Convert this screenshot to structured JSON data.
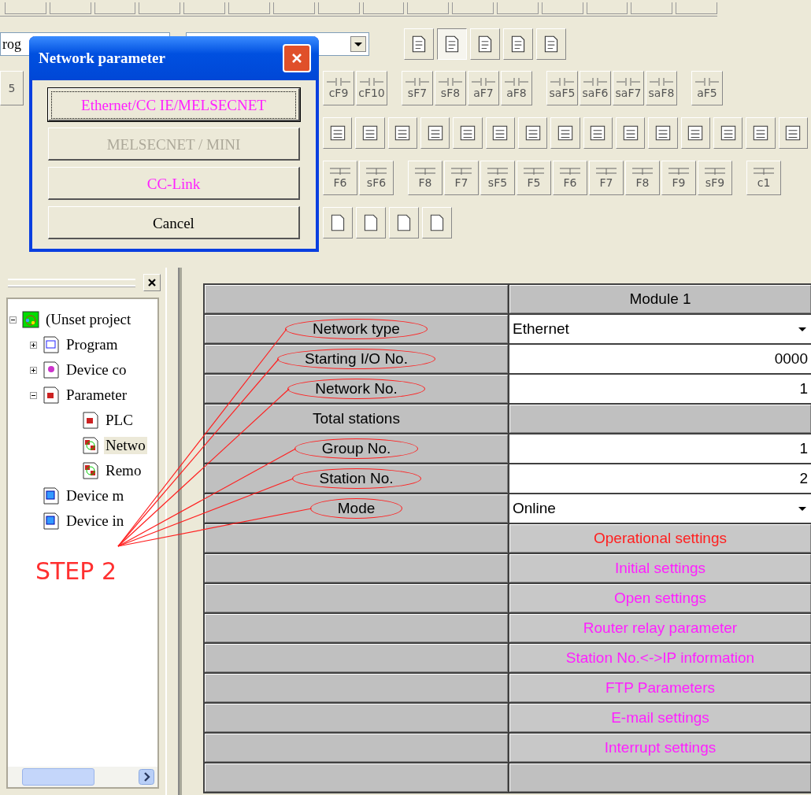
{
  "toolbar": {
    "program_combo": {
      "value": "rog"
    },
    "key_row_1": {
      "stub": "5",
      "groups": [
        [
          "cF9",
          "cF10"
        ],
        [
          "sF7",
          "sF8",
          "aF7",
          "aF8"
        ],
        [
          "saF5",
          "saF6",
          "saF7",
          "saF8"
        ],
        [
          "aF5"
        ]
      ]
    },
    "key_row_2": {
      "groups": [
        [
          "F6",
          "sF6"
        ],
        [
          "F8",
          "F7",
          "sF5",
          "F5",
          "F6",
          "F7",
          "F8",
          "F9",
          "sF9"
        ],
        [
          "c1"
        ]
      ]
    }
  },
  "dialog": {
    "title": "Network parameter",
    "buttons": [
      {
        "label": "Ethernet/CC IE/MELSECNET",
        "kind": "network",
        "disabled": false,
        "focused": true
      },
      {
        "label": "MELSECNET / MINI",
        "kind": "network",
        "disabled": true,
        "focused": false
      },
      {
        "label": "CC-Link",
        "kind": "network",
        "disabled": false,
        "focused": false
      },
      {
        "label": "Cancel",
        "kind": "plain",
        "disabled": false,
        "focused": false
      }
    ]
  },
  "tree": [
    {
      "label": "(Unset project",
      "kind": "project",
      "expanded": true,
      "selected": false,
      "children": [
        {
          "label": "Program",
          "kind": "program",
          "expanded": false,
          "selected": false
        },
        {
          "label": "Device co",
          "kind": "comment",
          "expanded": false,
          "selected": false
        },
        {
          "label": "Parameter",
          "kind": "parameter",
          "expanded": true,
          "selected": false,
          "children": [
            {
              "label": "PLC",
              "kind": "parameter",
              "selected": false
            },
            {
              "label": "Netwo",
              "kind": "network",
              "selected": true
            },
            {
              "label": "Remo",
              "kind": "network",
              "selected": false
            }
          ]
        },
        {
          "label": "Device m",
          "kind": "device",
          "selected": false
        },
        {
          "label": "Device in",
          "kind": "device-init",
          "selected": false
        }
      ]
    }
  ],
  "annotation": {
    "label": "STEP 2"
  },
  "grid": {
    "header": "Module 1",
    "rows": [
      {
        "label": "Network type",
        "kind": "dropdown",
        "value": "Ethernet",
        "circled": true
      },
      {
        "label": "Starting I/O No.",
        "kind": "number",
        "value": "0000",
        "circled": true
      },
      {
        "label": "Network No.",
        "kind": "number",
        "value": "1",
        "circled": true
      },
      {
        "label": "Total stations",
        "kind": "blank",
        "circled": false
      },
      {
        "label": "Group No.",
        "kind": "number",
        "value": "1",
        "circled": true
      },
      {
        "label": "Station No.",
        "kind": "number",
        "value": "2",
        "circled": true
      },
      {
        "label": "Mode",
        "kind": "dropdown",
        "value": "Online",
        "circled": true
      }
    ],
    "setting_buttons": [
      {
        "label": "Operational settings",
        "color": "#ff2020"
      },
      {
        "label": "Initial settings",
        "color": "#ff20ff"
      },
      {
        "label": "Open settings",
        "color": "#ff20ff"
      },
      {
        "label": "Router relay parameter",
        "color": "#ff20ff"
      },
      {
        "label": "Station No.<->IP information",
        "color": "#ff20ff"
      },
      {
        "label": "FTP Parameters",
        "color": "#ff20ff"
      },
      {
        "label": "E-mail settings",
        "color": "#ff20ff"
      },
      {
        "label": "Interrupt settings",
        "color": "#ff20ff"
      }
    ]
  }
}
